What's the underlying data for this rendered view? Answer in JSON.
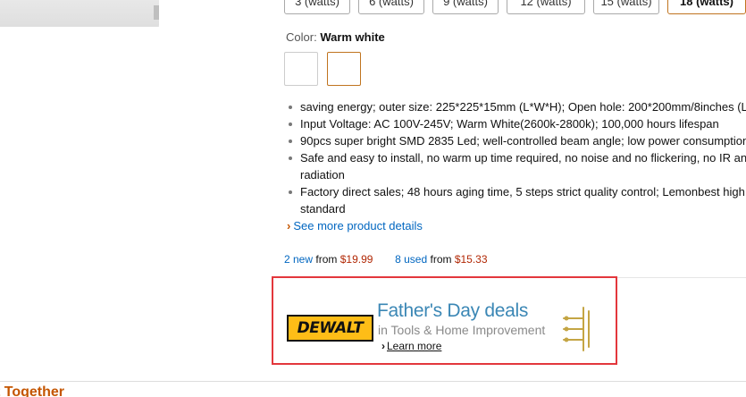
{
  "size_options": [
    {
      "label": "3 (watts)",
      "selected": false
    },
    {
      "label": "6 (watts)",
      "selected": false
    },
    {
      "label": "9 (watts)",
      "selected": false
    },
    {
      "label": "12 (watts)",
      "selected": false
    },
    {
      "label": "15 (watts)",
      "selected": false
    },
    {
      "label": "18 (watts)",
      "selected": true
    }
  ],
  "color": {
    "label": "Color:",
    "value": "Warm white"
  },
  "features": [
    {
      "line1": "saving energy; outer size: 225*225*15mm (L*W*H); Open hole: 200*200mm/8inches (L"
    },
    {
      "line1": "Input Voltage: AC 100V-245V; Warm White(2600k-2800k); 100,000 hours lifespan"
    },
    {
      "line1": "90pcs super bright SMD 2835 Led; well-controlled beam angle; low power consumption"
    },
    {
      "line1": "Safe and easy to install, no warm up time required, no noise and no flickering, no IR and",
      "line2": "radiation"
    },
    {
      "line1": "Factory direct sales; 48 hours aging time, 5 steps strict quality control; Lemonbest high",
      "line2": "standard"
    }
  ],
  "see_more": "See more product details",
  "offers": {
    "new_link": "2 new",
    "new_from": "from",
    "new_price": "$19.99",
    "used_link": "8 used",
    "used_from": "from",
    "used_price": "$15.33"
  },
  "ad": {
    "logo_text": "DEWALT",
    "headline": "Father's Day deals",
    "subline": "in Tools & Home Improvement",
    "learn_more": "Learn more",
    "border_color": "#e3373c"
  },
  "section_title": "t Together"
}
